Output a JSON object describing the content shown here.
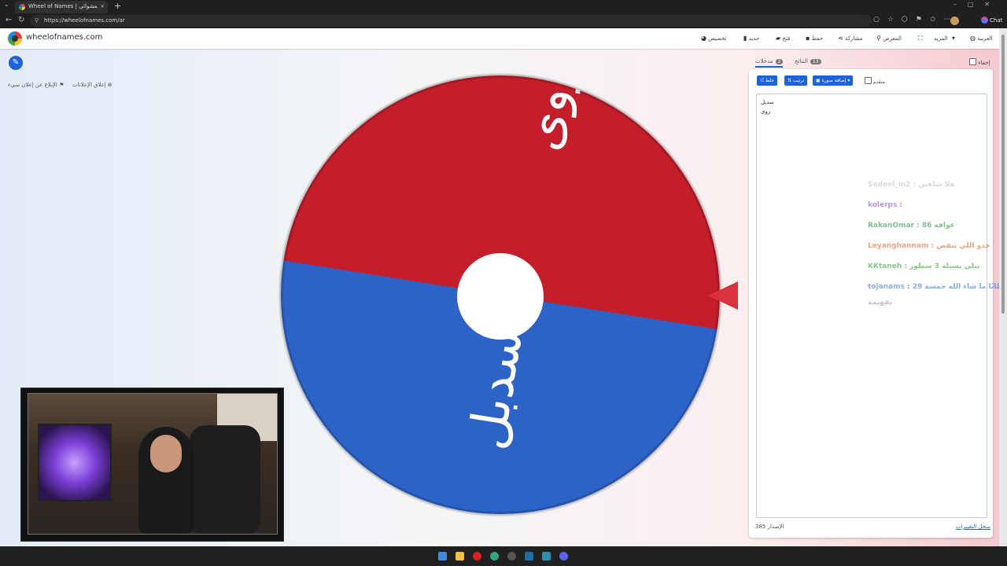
{
  "browser": {
    "tab_title": "Wheel of Names | الاسم العشوائي",
    "url": "https://wheelofnames.com/ar",
    "chat_label": "Chat"
  },
  "header": {
    "site_name": "wheelofnames.com",
    "menu": {
      "language": "العربية",
      "more": "المزيد",
      "gallery": "المعرض",
      "share": "مشاركة",
      "save": "حفظ",
      "open": "فتح",
      "new": "جديد",
      "customize": "تخصيص"
    }
  },
  "ads": {
    "close_ads": "إغلاق الإعلانات",
    "report_ad": "الإبلاغ عن إعلان سيء"
  },
  "wheel": {
    "segments": [
      "روى",
      "سدبل"
    ],
    "colors": {
      "top": "#c41e2a",
      "bottom": "#2d63c6",
      "pointer": "#d8333f"
    }
  },
  "panel": {
    "hide_label": "إخفاء",
    "tab_entries": "مدخلات",
    "entries_count": "2",
    "tab_results": "النتائج",
    "results_count": "13",
    "shuffle": "خلط",
    "sort": "ترتيب",
    "add_image": "إضافة صورة",
    "advanced": "متقدم",
    "entries": [
      "سدبل",
      "روى"
    ],
    "version_label": "الإصدار",
    "version": "385",
    "changelog": "سجل التغييرات"
  },
  "overlay_chat": [
    {
      "text": "Sadeel_m2 : هلا شاهين",
      "color": "#bdbdbd"
    },
    {
      "text": "kolerps :",
      "color": "#7b3fd6"
    },
    {
      "text": "RakanOmar : عوافه 86",
      "color": "#1b8a3a"
    },
    {
      "text": "Leyanghannam : خذو اللي تنقص",
      "color": "#d65b2a"
    },
    {
      "text": "KKtaneh : بيلي بسيلة 3 سطور",
      "color": "#2c9a2c"
    },
    {
      "text": "tojanams : 29 سطانًا ما شاء الله خمسة",
      "color": "#2a6fd6"
    },
    {
      "text": "يفهيمة",
      "color": "#999999"
    }
  ]
}
